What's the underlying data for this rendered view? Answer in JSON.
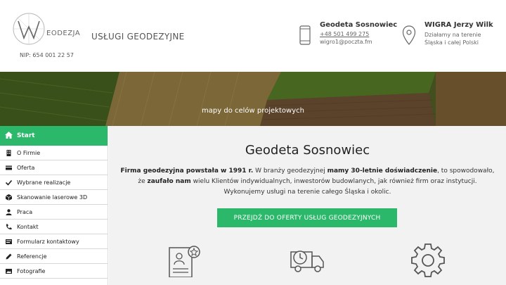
{
  "header": {
    "logo_text": "EODEZJA",
    "nip": "NIP: 654 001 22 57",
    "tagline": "USŁUGI GEODEZYJNE",
    "contact": {
      "title": "Geodeta Sosnowiec",
      "phone": "+48 501 499 275",
      "email": "wigro1@poczta.fm"
    },
    "firm": {
      "name": "WIGRA Jerzy Wilk",
      "line1": "Działamy na terenie",
      "line2": "Śląska i całej Polski"
    }
  },
  "hero": {
    "caption": "mapy do celów projektowych"
  },
  "sidebar": {
    "start": "Start",
    "items": [
      {
        "label": "O Firmie",
        "icon": "building-icon"
      },
      {
        "label": "Oferta",
        "icon": "card-icon"
      },
      {
        "label": "Wybrane realizacje",
        "icon": "check-icon"
      },
      {
        "label": "Skanowanie laserowe 3D",
        "icon": "cube-icon"
      },
      {
        "label": "Praca",
        "icon": "user-icon"
      },
      {
        "label": "Kontakt",
        "icon": "phone-icon"
      },
      {
        "label": "Formularz kontaktowy",
        "icon": "form-icon"
      },
      {
        "label": "Referencje",
        "icon": "pencil-icon"
      },
      {
        "label": "Fotografie",
        "icon": "image-icon"
      }
    ]
  },
  "main": {
    "title": "Geodeta Sosnowiec",
    "p1_b1": "Firma geodezyjna powstała w 1991 r.",
    "p1_t1": " W branży geodezyjnej ",
    "p1_b2": "mamy 30-letnie doświadczenie",
    "p1_t2": ", to spowodowało,",
    "p2_t1": "że ",
    "p2_b1": "zaufało nam",
    "p2_t2": " wielu Klientów indywidualnych, inwestorów budowlanych, jak również firm oraz instytucji.",
    "p3": "Wykonujemy usługi na terenie całego Śląska i okolic.",
    "cta": "PRZEJDŹ DO OFERTY USŁUG GEODEZYJNYCH"
  },
  "colors": {
    "accent": "#2bb86a",
    "main_bg": "#f2f2f2"
  }
}
